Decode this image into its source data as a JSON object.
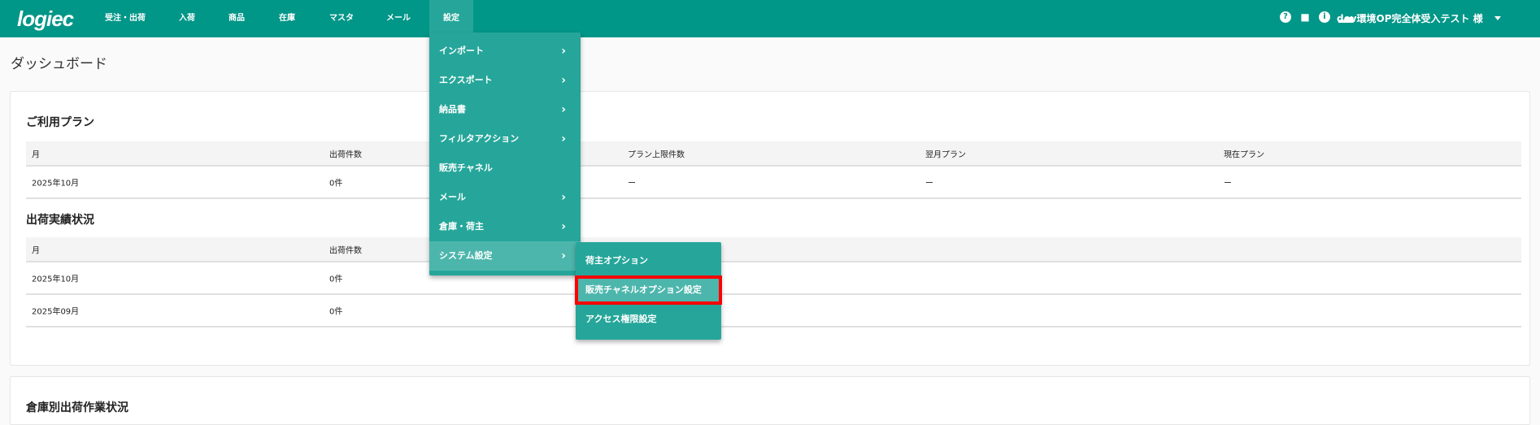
{
  "header": {
    "logo": "logiec",
    "nav": [
      "受注・出荷",
      "入荷",
      "商品",
      "在庫",
      "マスタ",
      "メール",
      "設定"
    ],
    "user": "dev環境OP完全体受入テスト 様",
    "icons": [
      "help-icon",
      "bag-icon",
      "info-icon",
      "signal-icon"
    ]
  },
  "page_title": "ダッシュボード",
  "plan": {
    "title": "ご利用プラン",
    "headers": [
      "月",
      "出荷件数",
      "プラン上限件数",
      "翌月プラン",
      "現在プラン"
    ],
    "rows": [
      [
        "2025年10月",
        "0件",
        "ー",
        "ー",
        "ー"
      ]
    ]
  },
  "shipping": {
    "title": "出荷実績状況",
    "headers": [
      "月",
      "出荷件数"
    ],
    "rows": [
      [
        "2025年10月",
        "0件"
      ],
      [
        "2025年09月",
        "0件"
      ]
    ]
  },
  "warehouse": {
    "title": "倉庫別出荷作業状況"
  },
  "menu": {
    "items": [
      {
        "label": "インポート",
        "sub": true
      },
      {
        "label": "エクスポート",
        "sub": true
      },
      {
        "label": "納品書",
        "sub": true
      },
      {
        "label": "フィルタアクション",
        "sub": true
      },
      {
        "label": "販売チャネル",
        "sub": false
      },
      {
        "label": "メール",
        "sub": true
      },
      {
        "label": "倉庫・荷主",
        "sub": true
      },
      {
        "label": "システム設定",
        "sub": true
      }
    ],
    "chevron": "›"
  },
  "submenu": {
    "items": [
      "荷主オプション",
      "販売チャネルオプション設定",
      "アクセス権限設定"
    ]
  },
  "accent": "#009688"
}
